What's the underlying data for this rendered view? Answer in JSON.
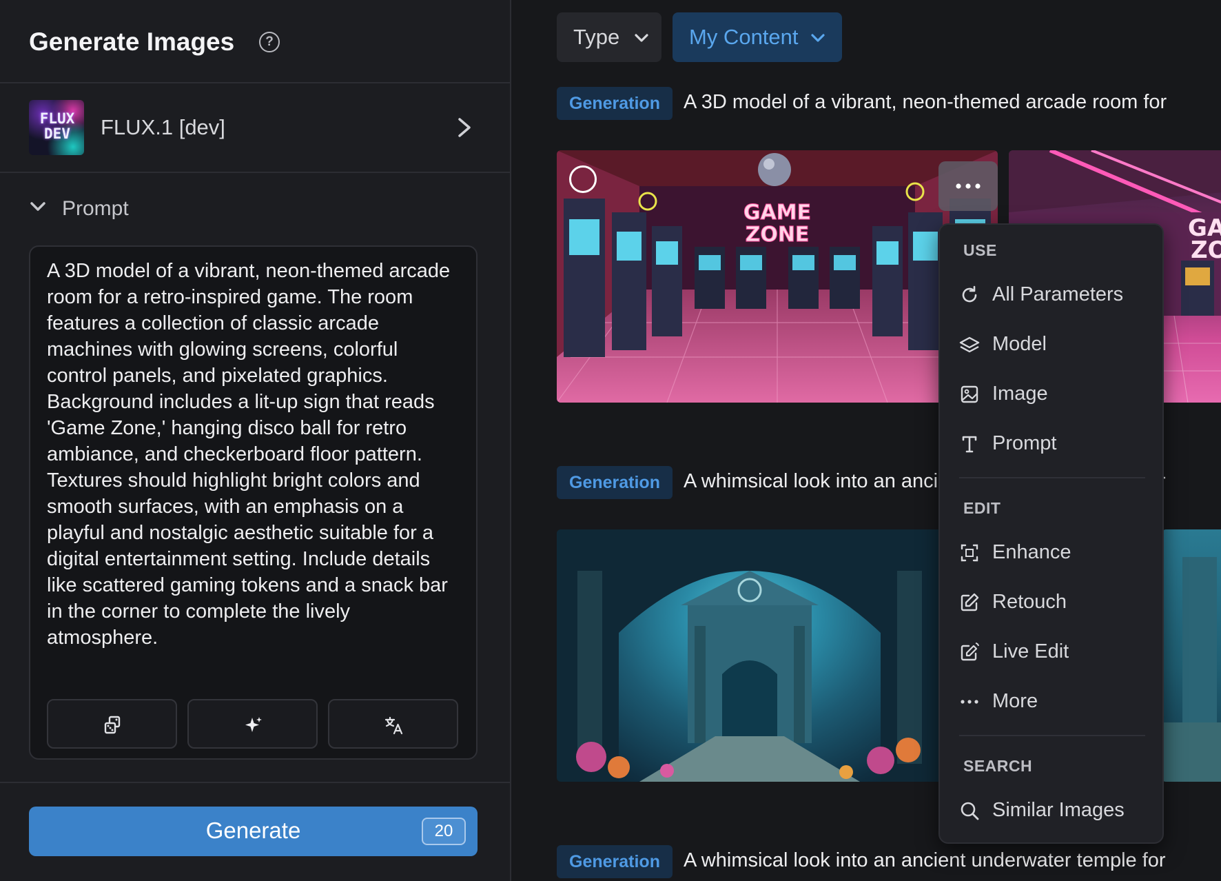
{
  "left_panel": {
    "title": "Generate Images",
    "help_glyph": "?",
    "model": {
      "logo_line1": "FLUX",
      "logo_line2": "DEV",
      "name": "FLUX.1 [dev]"
    },
    "prompt_section_label": "Prompt",
    "prompt_text": "A 3D model of a vibrant, neon-themed arcade room for a retro-inspired game. The room features a collection of classic arcade machines with glowing screens, colorful control panels, and pixelated graphics. Background includes a lit-up sign that reads 'Game Zone,' hanging disco ball for retro ambiance, and checkerboard floor pattern. Textures should highlight bright colors and smooth surfaces, with an emphasis on a playful and nostalgic aesthetic suitable for a digital entertainment setting. Include details like scattered gaming tokens and a snack bar in the corner to complete the lively atmosphere.",
    "tools": [
      "dice-icon",
      "sparkle-icon",
      "translate-icon"
    ],
    "generate_label": "Generate",
    "generate_cost": "20"
  },
  "filters": {
    "type_label": "Type",
    "content_label": "My Content"
  },
  "generations": [
    {
      "badge": "Generation",
      "text": "A 3D model of a vibrant, neon-themed arcade room for"
    },
    {
      "badge": "Generation",
      "text": "A whimsical look into an ancient underwater temple for"
    },
    {
      "badge": "Generation",
      "text": "A whimsical look into an ancient underwater temple for"
    }
  ],
  "context_menu": {
    "use_heading": "USE",
    "use_items": [
      "All Parameters",
      "Model",
      "Image",
      "Prompt"
    ],
    "edit_heading": "EDIT",
    "edit_items": [
      "Enhance",
      "Retouch",
      "Live Edit",
      "More"
    ],
    "search_heading": "SEARCH",
    "search_items": [
      "Similar Images"
    ]
  },
  "artwork_signs": {
    "arcade_sign_line1": "GAME",
    "arcade_sign_line2": "ZONE",
    "arcade2_sign_line1": "GA",
    "arcade2_sign_line2": "ZO"
  },
  "colors": {
    "accent": "#3b82c9",
    "badge_text": "#4f9ae4",
    "badge_bg": "#172e47",
    "panel_bg": "#1c1d21"
  }
}
